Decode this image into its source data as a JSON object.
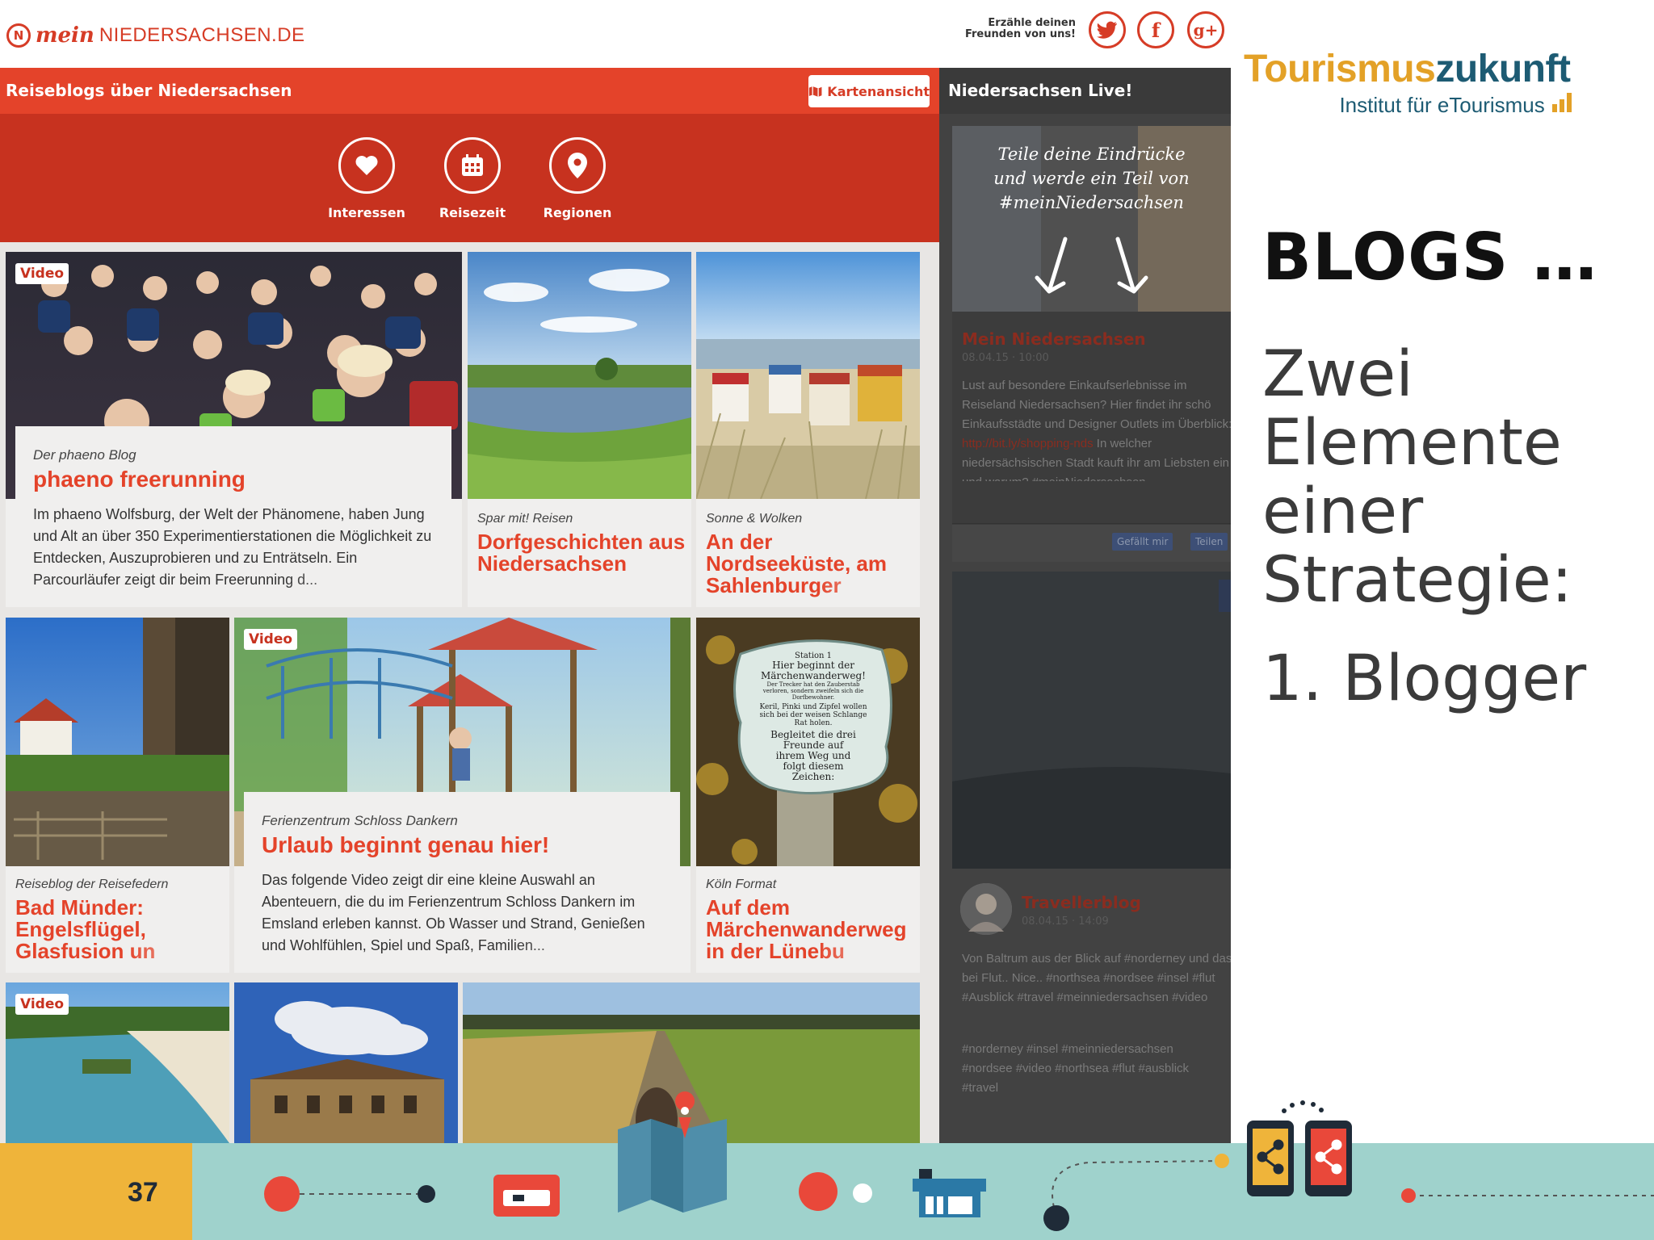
{
  "site": {
    "logo_mein": "mein",
    "logo_rest": "NIEDERSACHSEN.DE",
    "share_text": "Erzähle deinen Freunden von uns!",
    "social": [
      "twitter-icon",
      "facebook-icon",
      "google-plus-icon"
    ]
  },
  "header": {
    "title": "Reiseblogs über Niedersachsen",
    "map_button": "Kartenansicht"
  },
  "filters": [
    {
      "label": "Interessen",
      "icon": "heart-icon"
    },
    {
      "label": "Reisezeit",
      "icon": "calendar-icon"
    },
    {
      "label": "Regionen",
      "icon": "location-pin-icon"
    }
  ],
  "cards": {
    "c1": {
      "badge": "Video",
      "meta": "Der phaeno Blog",
      "title": "phaeno freerunning",
      "text": "Im phaeno Wolfsburg, der Welt der Phänomene, haben Jung und Alt an über 350 Experimentierstationen die Möglichkeit zu Entdecken, Auszuprobieren und zu Enträtseln. Ein Parcourläufer zeigt dir beim Freerunning d..."
    },
    "c2": {
      "meta": "Spar mit! Reisen",
      "title": "Dorfgeschichten aus Niedersachsen"
    },
    "c3": {
      "meta": "Sonne & Wolken",
      "title": "An der Nordseeküste, am Sahlenburger"
    },
    "c4": {
      "meta": "Reiseblog der Reisefedern",
      "title": "Bad Münder: Engelsflügel, Glasfusion un"
    },
    "c5": {
      "badge": "Video",
      "meta": "Ferienzentrum Schloss Dankern",
      "title": "Urlaub beginnt genau hier!",
      "text": "Das folgende Video zeigt dir eine kleine Auswahl an Abenteuern, die du im Ferienzentrum Schloss Dankern im Emsland erleben kannst. Ob Wasser und Strand, Genießen und Wohlfühlen, Spiel und Spaß, Familien..."
    },
    "c6": {
      "meta": "Köln Format",
      "title": "Auf dem Märchenwanderweg in der Lünebu",
      "sign": [
        "Station 1",
        "Hier beginnt der",
        "Märchenwanderweg!",
        "Der Trecker hat den Zauberstab",
        "verloren, sondern zweifeln sich die",
        "Dorfbewohner.",
        "Keril, Pinki und Zipfel wollen",
        "sich bei der weisen Schlange",
        "Rat holen.",
        "Begleitet die drei",
        "Freunde auf",
        "ihrem Weg und",
        "folgt diesem",
        "Zeichen:"
      ]
    },
    "c7": {
      "badge": "Video"
    }
  },
  "live": {
    "title": "Niedersachsen Live!",
    "promo": [
      "Teile deine Eindrücke",
      "und werde ein Teil von",
      "#meinNiedersachsen"
    ],
    "post1_name": "Mein Niedersachsen",
    "post1_date": "08.04.15 · 10:00",
    "post1_text_a": "Lust auf besondere Einkaufserlebnisse im Reiseland Niedersachsen? Hier findet ihr schö Einkaufsstädte und Designer Outlets im Überblick: ",
    "post1_link": "http://bit.ly/shopping-nds",
    "post1_text_b": " In welcher niedersächsischen Stadt kauft ihr am Liebsten ein und warum? #meinNiedersachsen",
    "like": "Gefällt mir",
    "share": "Teilen",
    "post2_name": "Travellerblog",
    "post2_date": "08.04.15 · 14:09",
    "post2_text": "Von Baltrum aus der Blick auf #norderney und das bei Flut.. Nice.. #northsea #nordsee #insel #flut #Ausblick #travel #meinniedersachsen #video",
    "post2_tags": "#norderney #insel #meinniedersachsen #nordsee #video #northsea #flut #ausblick #travel"
  },
  "slide": {
    "brand_a": "Tourismus",
    "brand_b": "zukunft",
    "brand_sub": "Institut für eTourismus",
    "title": "BLOGS …",
    "body": [
      "Zwei",
      "Elemente",
      "einer",
      "Strategie:"
    ],
    "point": "1. Blogger",
    "page_number": "37"
  },
  "colors": {
    "red": "#e4432a",
    "dark_red": "#c7321f",
    "teal": "#9fd2cc",
    "yellow": "#efb43a",
    "navy": "#1d5b73",
    "orange": "#e3a127"
  }
}
